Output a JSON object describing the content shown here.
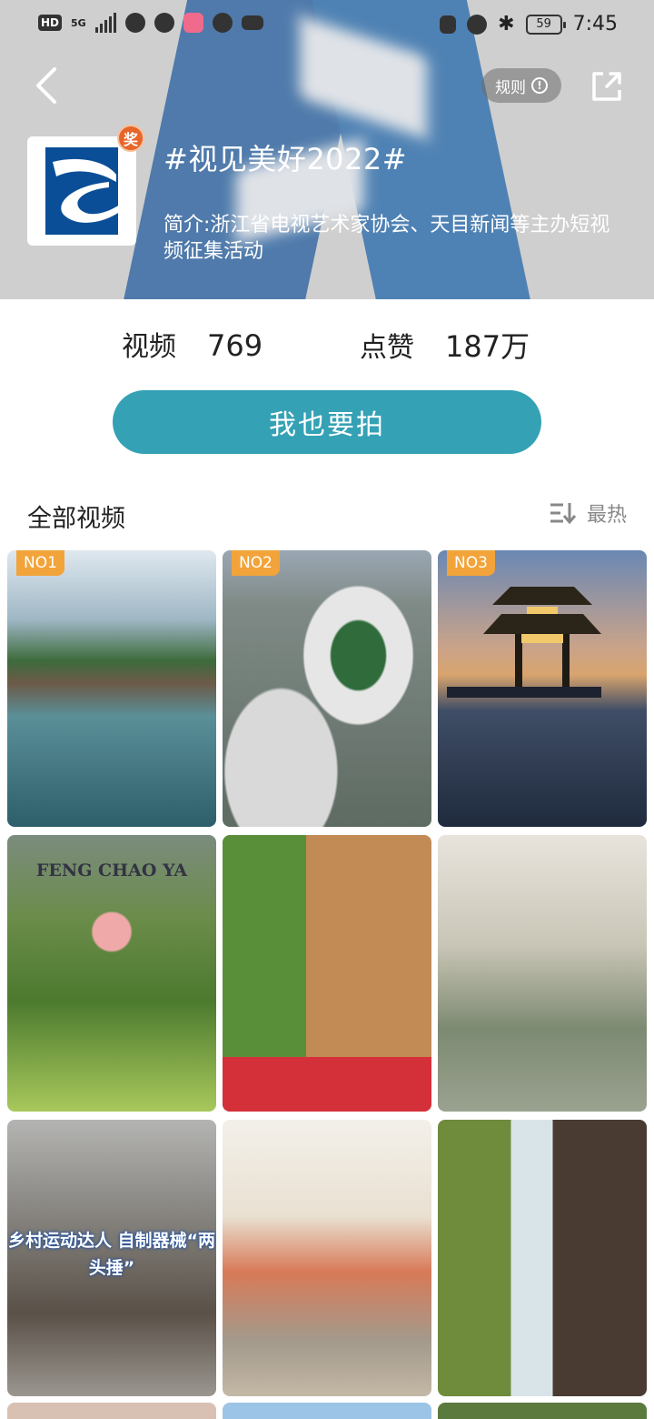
{
  "status_bar": {
    "hd": "HD",
    "net": "5G",
    "battery": "59",
    "time": "7:45"
  },
  "header": {
    "rules_label": "规则",
    "award_badge": "奖",
    "topic_title": "#视见美好2022#",
    "topic_desc": "简介:浙江省电视艺术家协会、天目新闻等主办短视频征集活动",
    "banner_color": "#0b4e98"
  },
  "stats": {
    "videos_label": "视频",
    "videos_value": "769",
    "likes_label": "点赞",
    "likes_value": "187万"
  },
  "cta": {
    "label": "我也要拍",
    "color": "#34a1b5"
  },
  "videos_section": {
    "title": "全部视频",
    "sort_label": "最热"
  },
  "tiles": [
    {
      "rank": "NO1",
      "icon": "covered-bridge-river"
    },
    {
      "rank": "NO2",
      "icon": "stadium-aerial"
    },
    {
      "rank": "NO3",
      "icon": "lake-pavilion-sunset"
    },
    {
      "rank": "",
      "icon": "water-lily",
      "caption": "FENG CHAO YA"
    },
    {
      "rank": "",
      "icon": "garden-gate-flowers"
    },
    {
      "rank": "",
      "icon": "violin-player"
    },
    {
      "rank": "",
      "icon": "weightlifting-man",
      "caption": "乡村运动达人 自制器械“两头捶”"
    },
    {
      "rank": "",
      "icon": "children-food"
    },
    {
      "rank": "",
      "icon": "waterfall"
    }
  ]
}
